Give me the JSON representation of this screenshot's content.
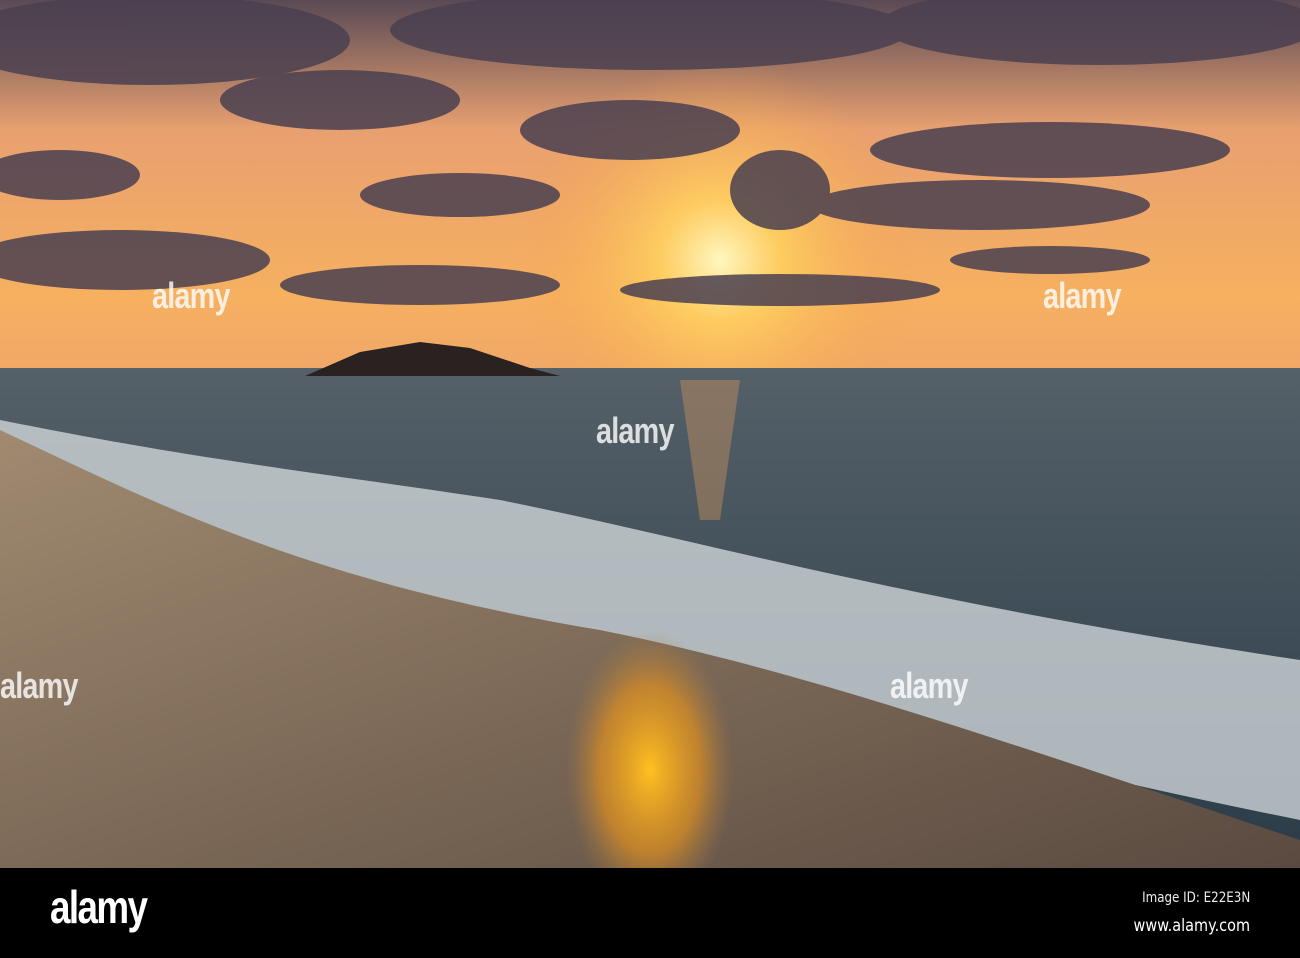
{
  "photo": {
    "subject": "sunset-beach"
  },
  "watermark": {
    "text": "alamy"
  },
  "footer": {
    "logo": "alamy",
    "image_id": "Image ID: E22E3N",
    "website": "www.alamy.com"
  }
}
